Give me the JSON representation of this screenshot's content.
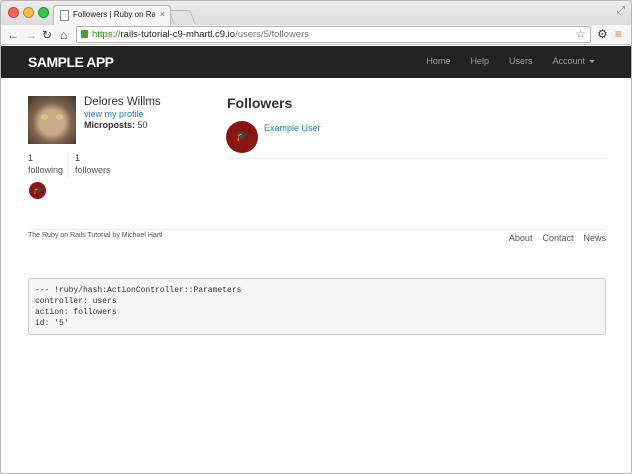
{
  "browser": {
    "tab_title": "Followers | Ruby on Rails T",
    "tab_close": "×",
    "url_scheme": "https://",
    "url_host": "rails-tutorial-c9-mhartl.c9.io",
    "url_path": "/users/5/followers",
    "icons": [
      "back-icon",
      "forward-icon",
      "reload-icon",
      "home-icon",
      "lock-icon",
      "star-icon",
      "gear-icon",
      "menu-icon"
    ]
  },
  "navbar": {
    "brand": "SAMPLE APP",
    "links": [
      "Home",
      "Help",
      "Users",
      "Account"
    ]
  },
  "profile": {
    "name": "Delores Willms",
    "profile_link": "view my profile",
    "microposts_label": "Microposts:",
    "microposts_count": "50",
    "following_count": "1",
    "following_label": "following",
    "followers_count": "1",
    "followers_label": "followers"
  },
  "main": {
    "title": "Followers",
    "followers": [
      "Example User"
    ]
  },
  "footer": {
    "text": "The Ruby on Rails Tutorial by Michael Hartl",
    "links": [
      "About",
      "Contact",
      "News"
    ]
  },
  "debug": {
    "lines": [
      "--- !ruby/hash:ActionController::Parameters",
      "controller: users",
      "action: followers",
      "id: '5'"
    ]
  },
  "colors": {
    "navbar": "#222222",
    "link": "#337ab7",
    "gravatar": "#8b1515"
  }
}
